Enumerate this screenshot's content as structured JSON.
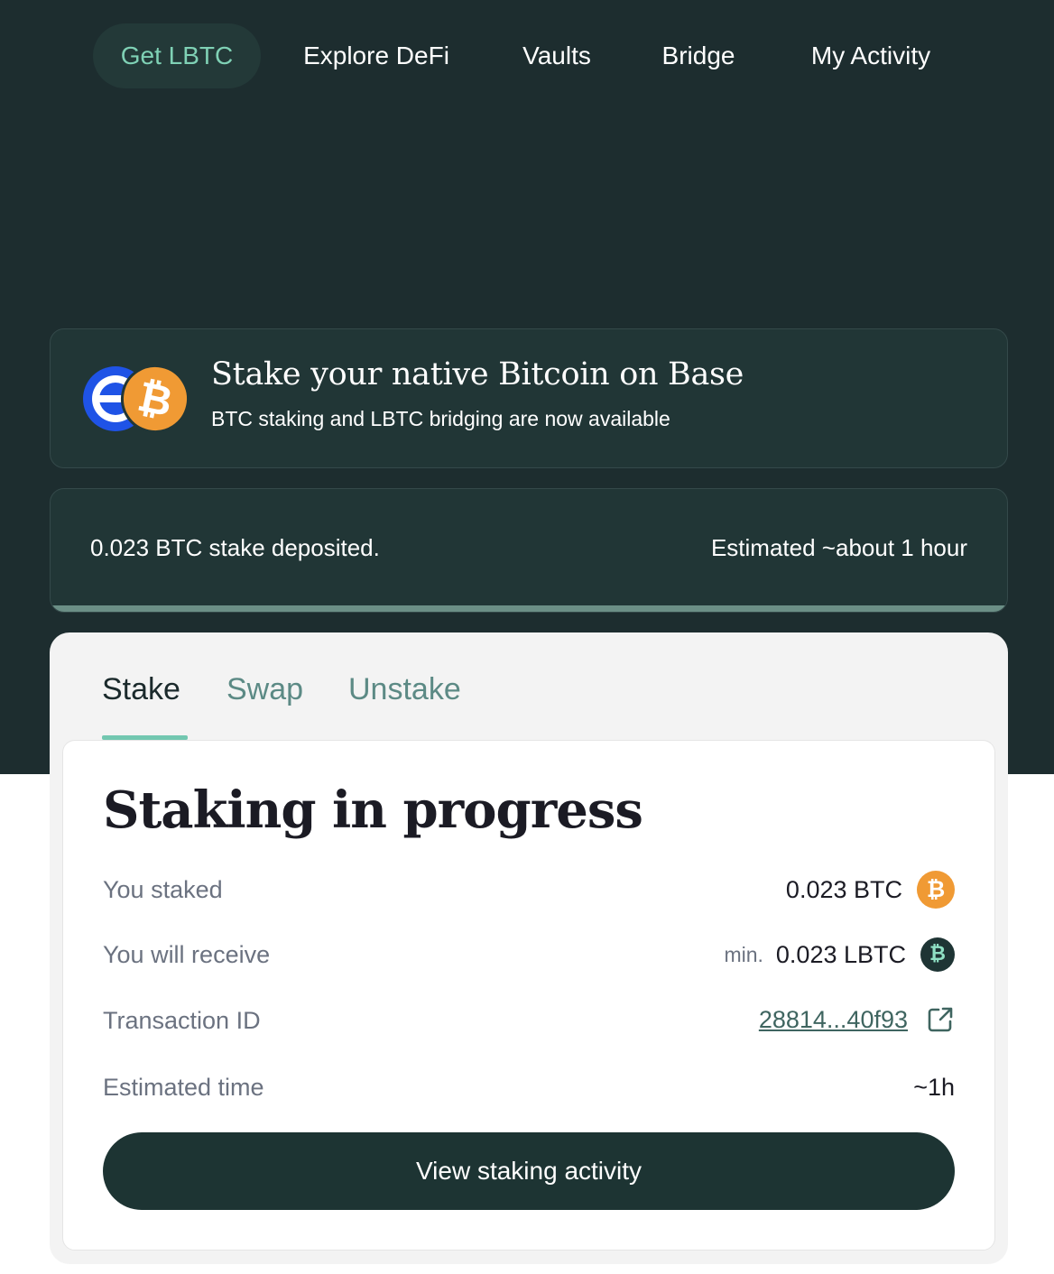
{
  "nav": {
    "items": [
      "Get LBTC",
      "Explore DeFi",
      "Vaults",
      "Bridge",
      "My Activity"
    ],
    "active_index": 0
  },
  "banner": {
    "title": "Stake your native Bitcoin on Base",
    "subtitle": "BTC staking and LBTC bridging are now available",
    "btc_symbol": "₿"
  },
  "status": {
    "message": "0.023 BTC stake deposited.",
    "estimate": "Estimated ~about 1 hour",
    "progress": 1.0
  },
  "tabs": [
    "Stake",
    "Swap",
    "Unstake"
  ],
  "panel": {
    "heading": "Staking in progress",
    "rows": {
      "staked": {
        "label": "You staked",
        "value": "0.023 BTC"
      },
      "receive": {
        "label": "You will receive",
        "prefix": "min.",
        "value": "0.023 LBTC"
      },
      "txid": {
        "label": "Transaction ID",
        "value": "28814...40f93"
      },
      "time": {
        "label": "Estimated time",
        "value": "~1h"
      }
    },
    "button_label": "View staking activity",
    "coin_symbol": "₿"
  },
  "colors": {
    "dark_background": "#1d2d2f",
    "accent": "#72c7b0",
    "bitcoin": "#f09a34",
    "base_blue": "#1f53e6"
  }
}
